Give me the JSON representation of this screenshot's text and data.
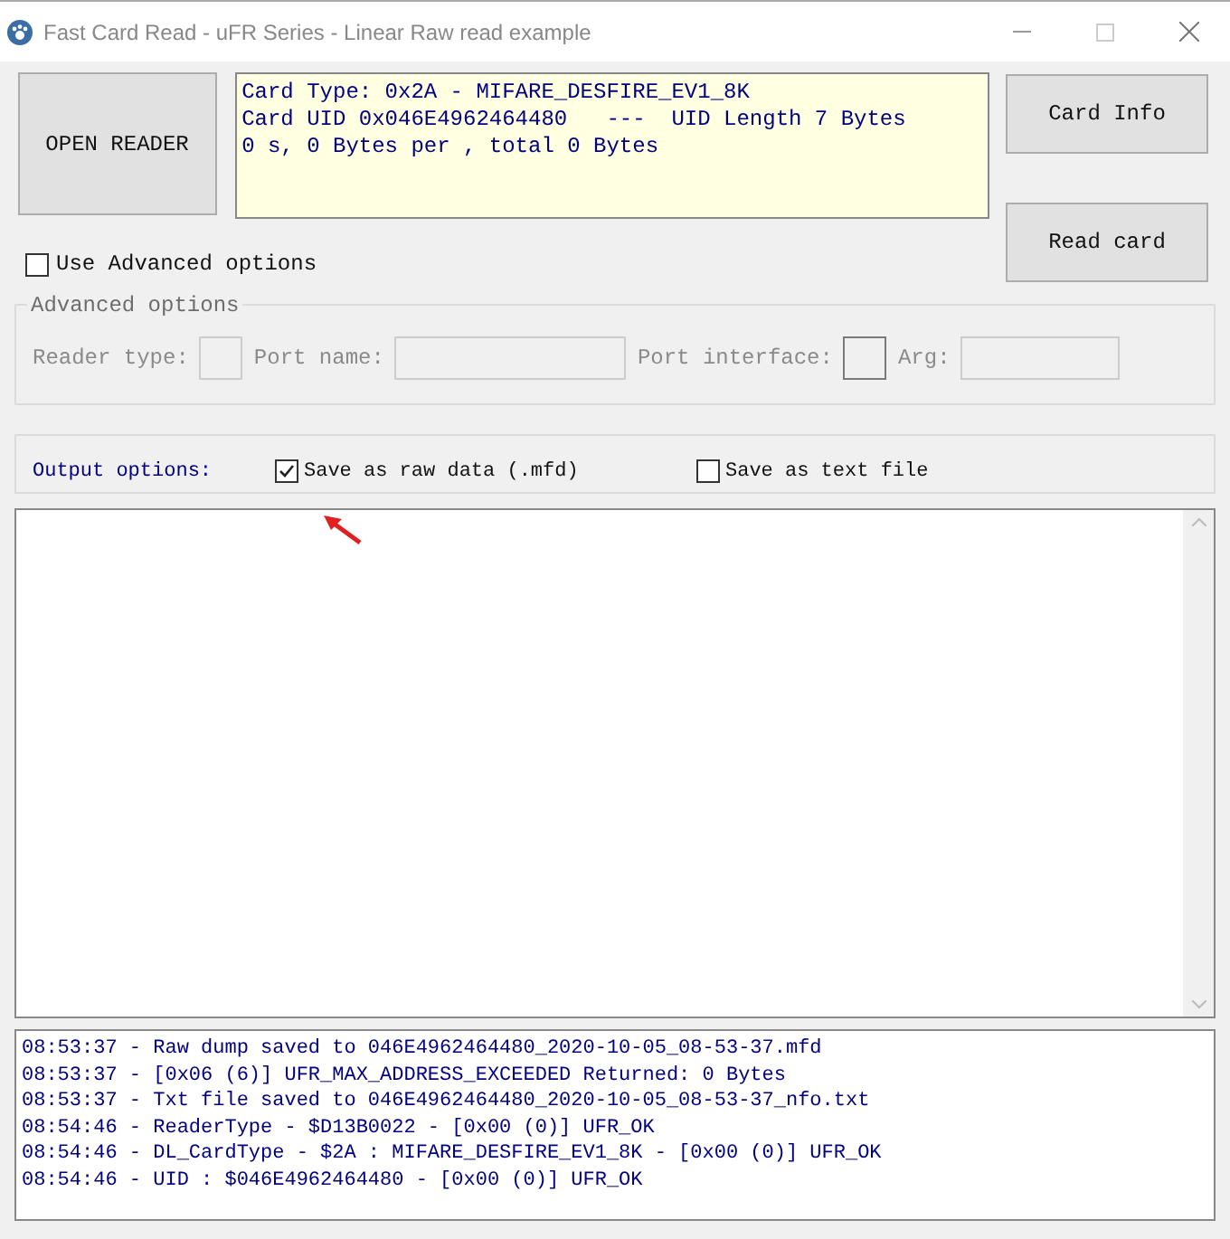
{
  "window": {
    "title": "Fast Card Read - uFR Series - Linear Raw read example"
  },
  "open_reader_button": "OPEN READER",
  "card_info_lines": [
    "Card Type: 0x2A - MIFARE_DESFIRE_EV1_8K",
    "Card UID 0x046E4962464480   ---  UID Length 7 Bytes",
    "0 s, 0 Bytes per , total 0 Bytes"
  ],
  "buttons": [
    "Card Info",
    "Read card"
  ],
  "use_advanced": {
    "label": "Use Advanced options",
    "checked": false
  },
  "advanced_options": {
    "title": "Advanced options",
    "disabled": true,
    "fields": [
      {
        "label": "Reader type:",
        "kind": "small"
      },
      {
        "label": "Port name:",
        "kind": "wide"
      },
      {
        "label": "Port interface:",
        "kind": "small"
      },
      {
        "label": "Arg:",
        "kind": "wide"
      }
    ]
  },
  "output_options": {
    "title": "Output options:",
    "options": [
      {
        "label": "Save as raw data (.mfd)",
        "checked": true
      },
      {
        "label": "Save as text file",
        "checked": false
      }
    ]
  },
  "log": [
    "08:53:37 - Raw dump saved to 046E4962464480_2020-10-05_08-53-37.mfd",
    "08:53:37 - [0x06 (6)] UFR_MAX_ADDRESS_EXCEEDED Returned: 0 Bytes",
    "08:53:37 - Txt file saved to 046E4962464480_2020-10-05_08-53-37_nfo.txt",
    "08:54:46 - ReaderType - $D13B0022 - [0x00 (0)] UFR_OK",
    "08:54:46 - DL_CardType - $2A : MIFARE_DESFIRE_EV1_8K - [0x00 (0)] UFR_OK",
    "08:54:46 - UID : $046E4962464480 - [0x00 (0)] UFR_OK"
  ]
}
